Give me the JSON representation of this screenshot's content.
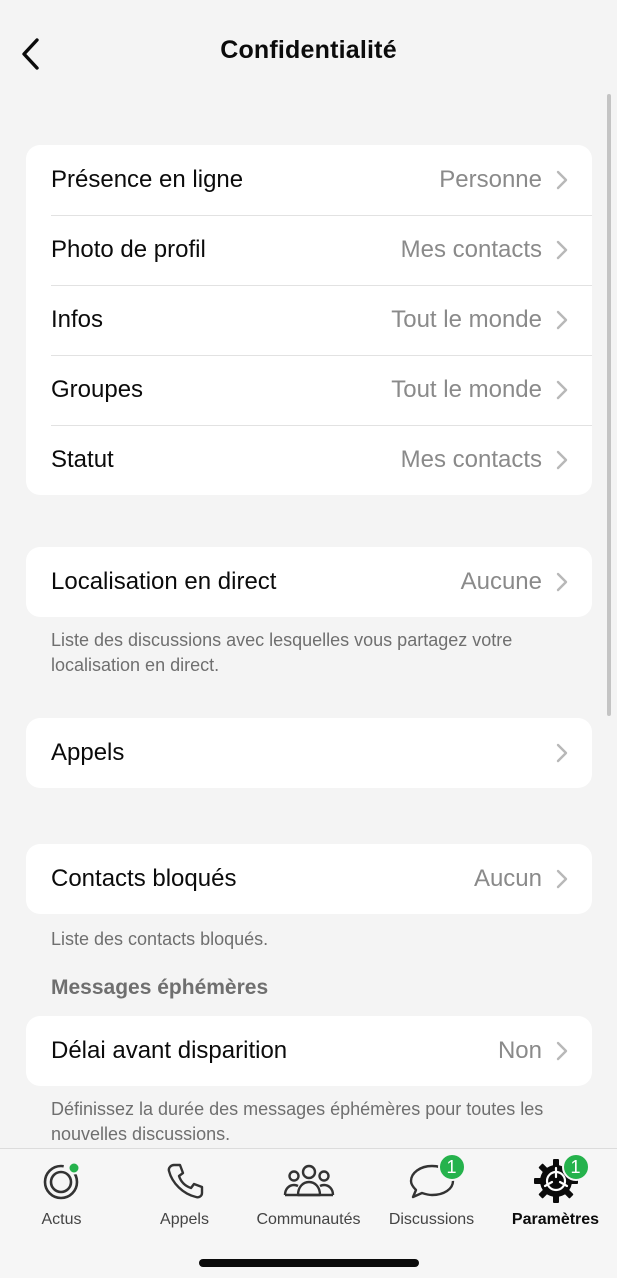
{
  "header": {
    "title": "Confidentialité"
  },
  "group1": {
    "rows": [
      {
        "label": "Présence en ligne",
        "value": "Personne"
      },
      {
        "label": "Photo de profil",
        "value": "Mes contacts"
      },
      {
        "label": "Infos",
        "value": "Tout le monde"
      },
      {
        "label": "Groupes",
        "value": "Tout le monde"
      },
      {
        "label": "Statut",
        "value": "Mes contacts"
      }
    ]
  },
  "live_location": {
    "label": "Localisation en direct",
    "value": "Aucune",
    "footnote": "Liste des discussions avec lesquelles vous partagez votre localisation en direct."
  },
  "calls": {
    "label": "Appels"
  },
  "blocked": {
    "label": "Contacts bloqués",
    "value": "Aucun",
    "footnote": "Liste des contacts bloqués."
  },
  "disappearing": {
    "section_title": "Messages éphémères",
    "label": "Délai avant disparition",
    "value": "Non",
    "footnote": "Définissez la durée des messages éphémères pour toutes les nouvelles discussions."
  },
  "tabbar": {
    "tabs": [
      {
        "label": "Actus",
        "icon": "status-icon"
      },
      {
        "label": "Appels",
        "icon": "phone-icon"
      },
      {
        "label": "Communautés",
        "icon": "communities-icon"
      },
      {
        "label": "Discussions",
        "icon": "chats-icon",
        "badge": "1"
      },
      {
        "label": "Paramètres",
        "icon": "settings-icon",
        "badge": "1"
      }
    ]
  },
  "colors": {
    "accent": "#25b24c",
    "background": "#f4f4f4",
    "card": "#ffffff"
  }
}
